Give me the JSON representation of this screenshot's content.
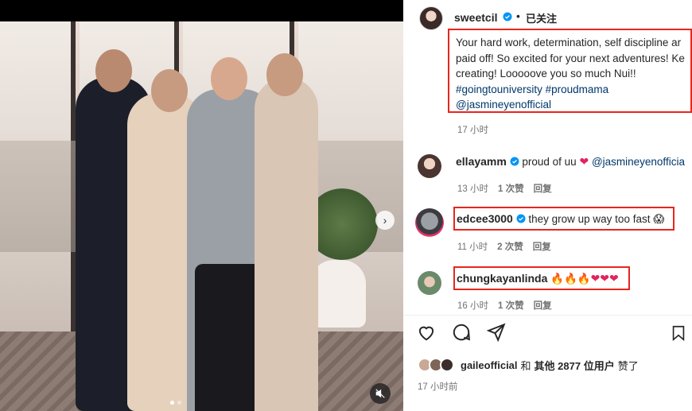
{
  "post": {
    "author": "sweetcil",
    "separator": "•",
    "follow_status": "已关注",
    "caption_line1": "Your hard work, determination, self discipline ar",
    "caption_line2": "paid off! So excited for your next adventures! Ke",
    "caption_line3": "creating! Looooove you so much Nui!!",
    "caption_tags": "#goingtouniversity #proudmama",
    "caption_mention": "@jasmineyenofficial",
    "caption_time": "17 小时"
  },
  "comments": [
    {
      "user": "ellayamm",
      "text": "proud of uu",
      "emoji": "❤",
      "mention": "@jasmineyenofficia",
      "time": "13 小时",
      "likes": "1 次赞",
      "reply": "回复"
    },
    {
      "user": "edcee3000",
      "text": "they grow up way too fast",
      "emoji": "😱",
      "time": "11 小时",
      "likes": "2 次赞",
      "reply": "回复"
    },
    {
      "user": "chungkayanlinda",
      "emoji_fire": "🔥",
      "emoji_heart": "❤",
      "time": "16 小时",
      "likes": "1 次赞",
      "reply": "回复"
    }
  ],
  "likes": {
    "first_user": "gaileofficial",
    "connector": "和",
    "others": "其他 2877 位用户",
    "suffix": "赞了"
  },
  "post_time": "17 小时前",
  "colors": {
    "highlight": "#e8261c",
    "verified": "#0095f6",
    "link": "#00376b",
    "meta": "#737373"
  },
  "icons": [
    "heart-icon",
    "comment-icon",
    "share-icon",
    "save-icon",
    "next-arrow-icon",
    "mute-icon",
    "verified-icon"
  ]
}
